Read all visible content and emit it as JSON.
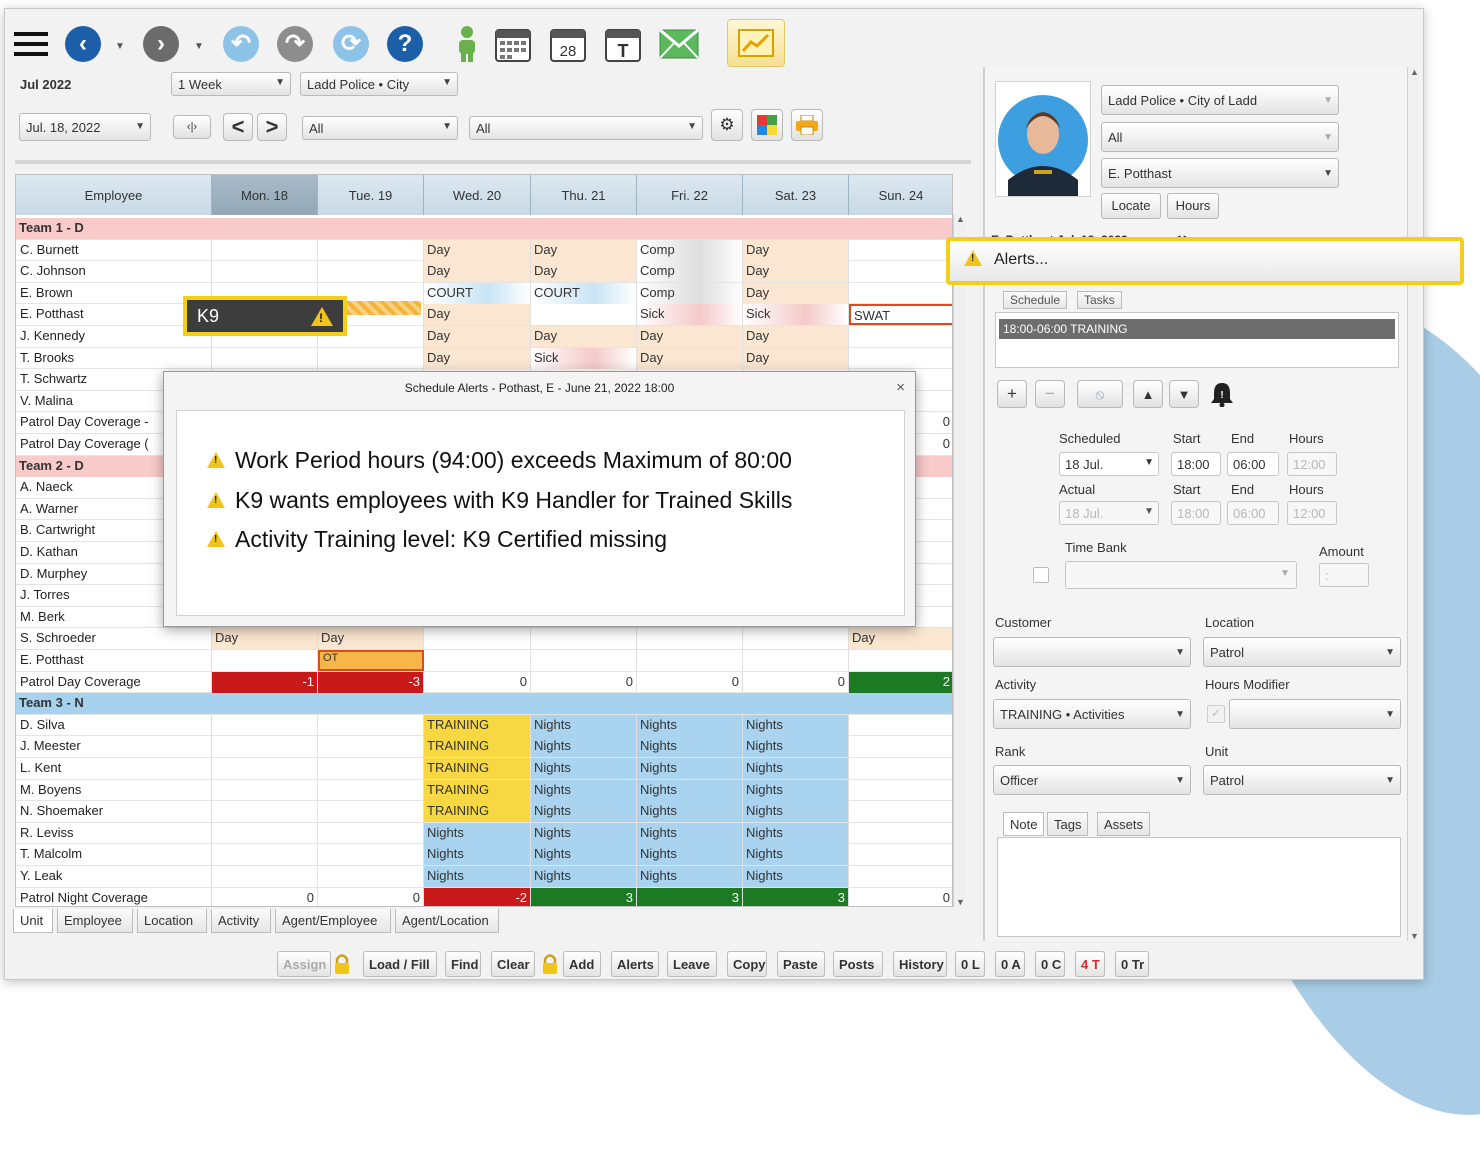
{
  "colors": {
    "accent": "#f4cf1a",
    "team_red": "#f8caca",
    "team_blue": "#a6d2ef",
    "day": "#fbe7d1",
    "nights": "#a9d3ee",
    "training": "#f8d842",
    "deficit": "#c81a1a",
    "surplus": "#1d7a24"
  },
  "toolbar": {
    "icons": [
      "menu-icon",
      "back-icon",
      "forward-icon",
      "undo-icon",
      "redo-icon",
      "refresh-icon",
      "help-icon",
      "person-icon",
      "calendar-week-icon",
      "calendar-day-icon",
      "calendar-today-icon",
      "mail-icon",
      "chart-icon"
    ],
    "calendar_day_number": "28",
    "calendar_today_letter": "T"
  },
  "filters": {
    "month": "Jul 2022",
    "period": "1 Week",
    "agency": "Ladd Police  •  City",
    "date": "Jul. 18, 2022",
    "filter1": "All",
    "filter2": "All"
  },
  "grid": {
    "headers": [
      "Employee",
      "Mon. 18",
      "Tue. 19",
      "Wed. 20",
      "Thu. 21",
      "Fri. 22",
      "Sat. 23",
      "Sun. 24"
    ],
    "rows": [
      {
        "type": "team",
        "label": "Team 1 - D",
        "color": "red"
      },
      {
        "name": "C. Burnett",
        "cells": [
          "",
          "",
          "Day",
          "Day",
          "Comp",
          "Day",
          ""
        ]
      },
      {
        "name": "C. Johnson",
        "cells": [
          "",
          "",
          "Day",
          "Day",
          "Comp",
          "Day",
          ""
        ]
      },
      {
        "name": "E. Brown",
        "cells": [
          "",
          "",
          "COURT",
          "COURT",
          "Comp",
          "Day",
          ""
        ]
      },
      {
        "name": "E. Potthast",
        "cells": [
          "",
          "",
          "Day",
          "",
          "Sick",
          "Sick",
          "SWAT"
        ]
      },
      {
        "name": "J. Kennedy",
        "cells": [
          "",
          "",
          "Day",
          "Day",
          "Day",
          "Day",
          ""
        ]
      },
      {
        "name": "T. Brooks",
        "cells": [
          "",
          "",
          "Day",
          "Sick",
          "Day",
          "Day",
          ""
        ]
      },
      {
        "name": "T. Schwartz",
        "cells": [
          "",
          "",
          "",
          "",
          "",
          "",
          ""
        ]
      },
      {
        "name": "V. Malina",
        "cells": [
          "",
          "",
          "",
          "",
          "",
          "",
          ""
        ]
      },
      {
        "name": "Patrol Day Coverage -",
        "cells": [
          "",
          "",
          "",
          "",
          "",
          "",
          "0"
        ]
      },
      {
        "name": "Patrol Day Coverage (",
        "cells": [
          "",
          "",
          "",
          "",
          "",
          "",
          "0"
        ]
      },
      {
        "type": "team",
        "label": "Team 2 - D",
        "color": "red"
      },
      {
        "name": "A. Naeck",
        "cells": [
          "",
          "",
          "",
          "",
          "",
          "",
          ""
        ]
      },
      {
        "name": "A. Warner",
        "cells": [
          "",
          "",
          "",
          "",
          "",
          "",
          ""
        ]
      },
      {
        "name": "B. Cartwright",
        "cells": [
          "",
          "",
          "",
          "",
          "",
          "",
          ""
        ]
      },
      {
        "name": "D. Kathan",
        "cells": [
          "",
          "",
          "",
          "",
          "",
          "",
          ""
        ]
      },
      {
        "name": "D. Murphey",
        "cells": [
          "",
          "",
          "",
          "",
          "",
          "",
          ""
        ]
      },
      {
        "name": "J. Torres",
        "cells": [
          "",
          "",
          "",
          "",
          "",
          "",
          ""
        ]
      },
      {
        "name": "M. Berk",
        "cells": [
          "",
          "",
          "",
          "",
          "",
          "",
          ""
        ]
      },
      {
        "name": "S. Schroeder",
        "cells": [
          "Day",
          "Day",
          "",
          "",
          "",
          "",
          "Day"
        ]
      },
      {
        "name": "E. Potthast",
        "cells": [
          "",
          "OT",
          "",
          "",
          "",
          "",
          ""
        ]
      },
      {
        "name": "Patrol Day Coverage",
        "cells": [
          "-1",
          "-3",
          "0",
          "0",
          "0",
          "0",
          "2"
        ]
      },
      {
        "type": "team",
        "label": "Team 3 - N",
        "color": "blue"
      },
      {
        "name": "D. Silva",
        "cells": [
          "",
          "",
          "TRAINING",
          "Nights",
          "Nights",
          "Nights",
          ""
        ]
      },
      {
        "name": "J. Meester",
        "cells": [
          "",
          "",
          "TRAINING",
          "Nights",
          "Nights",
          "Nights",
          ""
        ]
      },
      {
        "name": "L. Kent",
        "cells": [
          "",
          "",
          "TRAINING",
          "Nights",
          "Nights",
          "Nights",
          ""
        ]
      },
      {
        "name": "M. Boyens",
        "cells": [
          "",
          "",
          "TRAINING",
          "Nights",
          "Nights",
          "Nights",
          ""
        ]
      },
      {
        "name": "N. Shoemaker",
        "cells": [
          "",
          "",
          "TRAINING",
          "Nights",
          "Nights",
          "Nights",
          ""
        ]
      },
      {
        "name": "R. Leviss",
        "cells": [
          "",
          "",
          "Nights",
          "Nights",
          "Nights",
          "Nights",
          ""
        ]
      },
      {
        "name": "T. Malcolm",
        "cells": [
          "",
          "",
          "Nights",
          "Nights",
          "Nights",
          "Nights",
          ""
        ]
      },
      {
        "name": "Y. Leak",
        "cells": [
          "",
          "",
          "Nights",
          "Nights",
          "Nights",
          "Nights",
          ""
        ]
      },
      {
        "name": "Patrol Night Coverage",
        "cells": [
          "0",
          "0",
          "-2",
          "3",
          "3",
          "3",
          "0"
        ]
      }
    ]
  },
  "k9_tag": {
    "label": "K9"
  },
  "dialog": {
    "title": "Schedule Alerts  -  Pothast, E  -  June 21, 2022  18:00",
    "close": "×",
    "alerts": [
      "Work Period hours (94:00) exceeds Maximum of 80:00",
      "K9 wants employees with K9 Handler for Trained Skills",
      "Activity Training level: K9 Certified missing"
    ]
  },
  "bottom_tabs": [
    "Unit",
    "Employee",
    "Location",
    "Activity",
    "Agent/Employee",
    "Agent/Location"
  ],
  "bottom_buttons": [
    "Assign",
    "Load / Fill",
    "Find",
    "Clear",
    "Add",
    "Alerts",
    "Leave",
    "Copy",
    "Paste",
    "Posts",
    "History",
    "0 L",
    "0 A",
    "0 C",
    "4 T",
    "0 Tr"
  ],
  "right": {
    "agency": "Ladd Police  •  City of Ladd",
    "filter": "All",
    "employee": "E. Potthast",
    "locate": "Locate",
    "hours": "Hours",
    "title_partial": "E. Potthast   Jul. 18, 2022",
    "alerts_button": "Alerts...",
    "tabs": [
      "Schedule",
      "Tasks"
    ],
    "selected_item": "18:00-06:00 TRAINING",
    "labels": {
      "scheduled": "Scheduled",
      "start": "Start",
      "end": "End",
      "hours": "Hours",
      "actual": "Actual",
      "time_bank": "Time Bank",
      "amount": "Amount",
      "customer": "Customer",
      "location": "Location",
      "activity": "Activity",
      "hours_modifier": "Hours Modifier",
      "rank": "Rank",
      "unit": "Unit"
    },
    "scheduled": {
      "date": "18 Jul.",
      "start": "18:00",
      "end": "06:00",
      "hours": "12:00"
    },
    "actual": {
      "date": "18 Jul.",
      "start": "18:00",
      "end": "06:00",
      "hours": "12:00"
    },
    "amount": ":",
    "customer": "",
    "location": "Patrol",
    "activity": "TRAINING  •  Activities",
    "rank": "Officer",
    "unit": "Patrol",
    "note_tabs": [
      "Note",
      "Tags",
      "Assets"
    ]
  }
}
